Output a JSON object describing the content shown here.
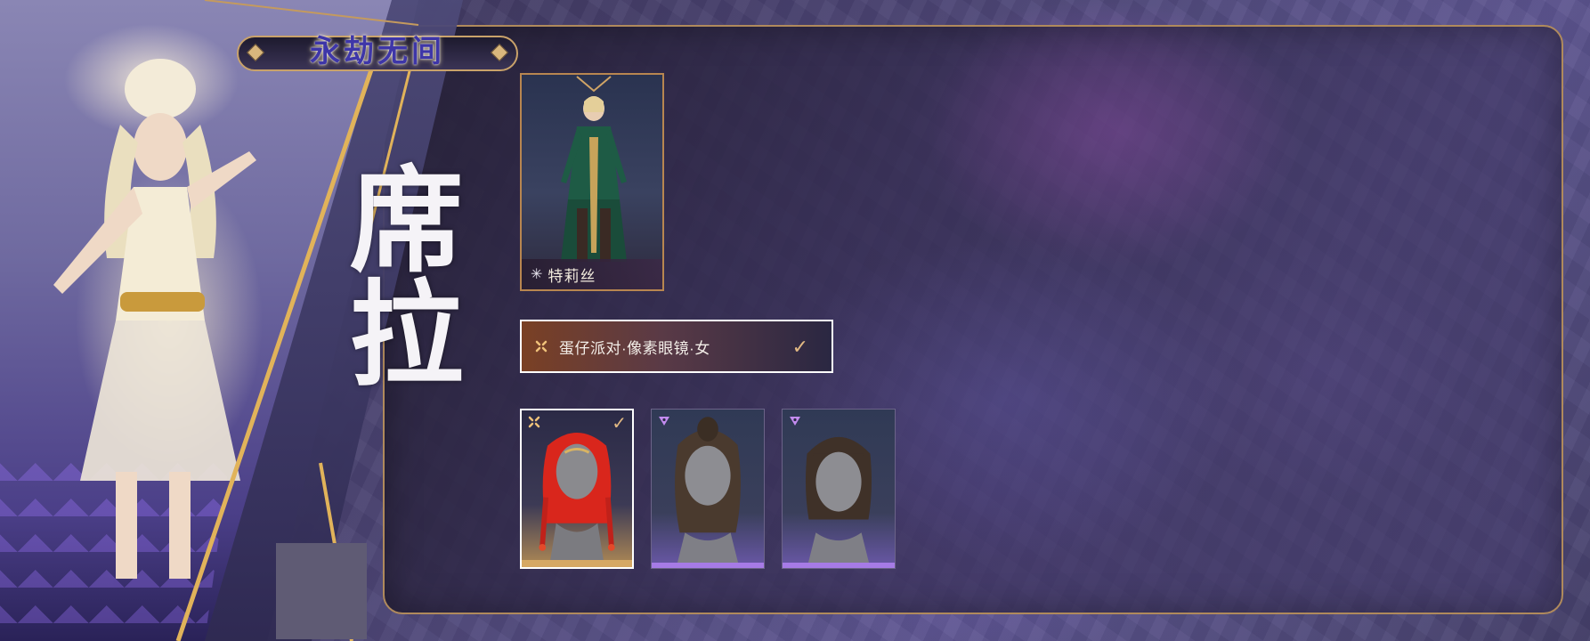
{
  "logo": {
    "text": "永劫无间"
  },
  "hero": {
    "name": "席拉"
  },
  "character_card": {
    "name": "特莉丝",
    "icon": "sparkle-icon"
  },
  "selected_option": {
    "label": "蛋仔派对·像素眼镜·女",
    "icon": "gold-sparkle-icon",
    "check": "✓"
  },
  "hair_tiles": [
    {
      "rarity": "gold",
      "selected": true,
      "check": "✓",
      "icon": "gold-sparkle-icon",
      "hair_color": "#d9261c"
    },
    {
      "rarity": "purple",
      "selected": false,
      "icon": "purple-triangle-icon",
      "hair_color": "#4a3a2e"
    },
    {
      "rarity": "purple",
      "selected": false,
      "icon": "purple-triangle-icon",
      "hair_color": "#3f3128"
    }
  ],
  "colors": {
    "gold_border": "#b08a5c",
    "purple_rarity": "#a67be6",
    "gold_rarity": "#d6a864",
    "check_gold": "#e2b983"
  }
}
